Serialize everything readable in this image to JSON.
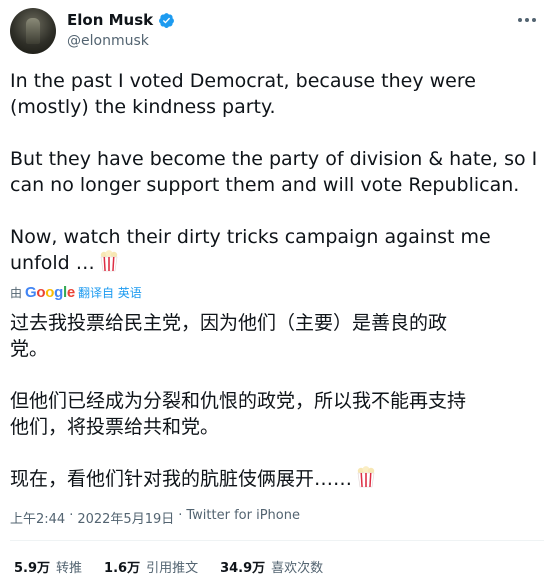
{
  "author": {
    "display_name": "Elon Musk",
    "handle": "@elonmusk"
  },
  "tweet": {
    "paragraphs": [
      [
        "In the past I voted Democrat, because they were",
        "(mostly) the kindness party."
      ],
      [
        "But they have become the party of division & hate, so I",
        "can no longer support them and will vote Republican."
      ],
      [
        "Now, watch their dirty tricks campaign against me",
        "unfold …"
      ]
    ],
    "emoji": "popcorn"
  },
  "translation": {
    "by_label": "由",
    "provider": "Google",
    "action_label": "翻译自 英语",
    "paragraphs": [
      [
        "过去我投票给民主党，因为他们（主要）是善良的政",
        "党。"
      ],
      [
        "但他们已经成为分裂和仇恨的政党，所以我不能再支持",
        "他们，将投票给共和党。"
      ],
      [
        "现在，看他们针对我的肮脏伎俩展开……"
      ]
    ]
  },
  "meta": {
    "time": "上午2:44",
    "separator": "·",
    "date": "2022年5月19日",
    "source": "Twitter for iPhone"
  },
  "stats": [
    {
      "num": "5.9万",
      "label": "转推"
    },
    {
      "num": "1.6万",
      "label": "引用推文"
    },
    {
      "num": "34.9万",
      "label": "喜欢次数"
    }
  ],
  "colors": {
    "text": "#0f1419",
    "muted": "#536471",
    "verified": "#1d9bf0",
    "link": "#1d9bf0"
  }
}
